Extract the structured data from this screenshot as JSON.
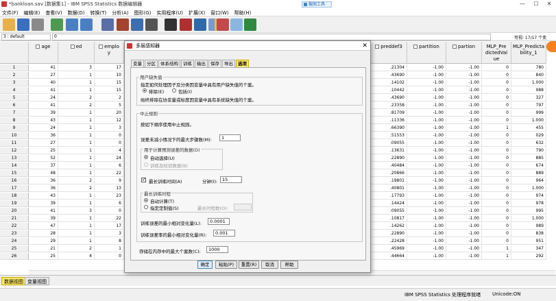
{
  "window": {
    "title": "*bankloan.sav [数据集1] - IBM SPSS Statistics 数据编辑器",
    "float_button": "截图工具",
    "controls": [
      "—",
      "☐",
      "✕"
    ]
  },
  "menu": [
    "文件(F)",
    "编辑(E)",
    "查看(V)",
    "数据(D)",
    "转换(T)",
    "分析(A)",
    "图形(G)",
    "实用程序(U)",
    "扩展(X)",
    "窗口(W)",
    "帮助(H)"
  ],
  "toolbar_icons": [
    "open-folder-icon",
    "save-icon",
    "print-icon",
    "dialog-recall-icon",
    "undo-icon",
    "redo-icon",
    "goto-case-icon",
    "goto-variable-icon",
    "variables-icon",
    "run-descriptives-icon",
    "find-icon",
    "insert-cases-icon",
    "insert-variable-icon",
    "split-file-icon",
    "weight-cases-icon",
    "value-labels-icon",
    "use-sets-icon",
    "show-all-icon"
  ],
  "refbar": {
    "cell_ref": "3 : default",
    "cell_value": "0",
    "var_count": "可视: 17/17 个变"
  },
  "grid": {
    "left_columns": [
      "age",
      "ed",
      "emplo\ny"
    ],
    "right_columns": [
      "preddef3",
      "partition",
      "partion",
      "MLP_Pre\ndictedVal\nue",
      "MLP_Predicta\nbility_1"
    ],
    "row_numbers": [
      "1",
      "2",
      "3",
      "4",
      "5",
      "6",
      "7",
      "8",
      "9",
      "10",
      "11",
      "12",
      "13",
      "14",
      "15",
      "16",
      "17",
      "18",
      "19",
      "20",
      "21",
      "22",
      "23",
      "24",
      "25",
      "26"
    ],
    "left_rows": [
      [
        "41",
        "3",
        "17"
      ],
      [
        "27",
        "1",
        "10"
      ],
      [
        "40",
        "1",
        "15"
      ],
      [
        "41",
        "1",
        "15"
      ],
      [
        "24",
        "2",
        "2"
      ],
      [
        "41",
        "2",
        "5"
      ],
      [
        "39",
        "1",
        "20"
      ],
      [
        "43",
        "1",
        "12"
      ],
      [
        "24",
        "1",
        "3"
      ],
      [
        "36",
        "1",
        "0"
      ],
      [
        "27",
        "1",
        "0"
      ],
      [
        "25",
        "1",
        "4"
      ],
      [
        "52",
        "1",
        "24"
      ],
      [
        "37",
        "1",
        "6"
      ],
      [
        "48",
        "1",
        "22"
      ],
      [
        "36",
        "2",
        "9"
      ],
      [
        "36",
        "2",
        "13"
      ],
      [
        "43",
        "1",
        "23"
      ],
      [
        "39",
        "1",
        "6"
      ],
      [
        "41",
        "3",
        "0"
      ],
      [
        "39",
        "1",
        "22"
      ],
      [
        "47",
        "1",
        "17"
      ],
      [
        "28",
        "1",
        "3"
      ],
      [
        "29",
        "1",
        "8"
      ],
      [
        "21",
        "2",
        "1"
      ],
      [
        "25",
        "4",
        "0"
      ]
    ],
    "right_rows": [
      [
        ".21304",
        "-1.00",
        "-1.00",
        "0",
        "780"
      ],
      [
        ".43690",
        "-1.00",
        "-1.00",
        "0",
        "840"
      ],
      [
        ".14102",
        "-1.00",
        "-1.00",
        "0",
        "1.000"
      ],
      [
        ".10442",
        "-1.00",
        "-1.00",
        "0",
        "988"
      ],
      [
        ".43690",
        "-1.00",
        "-1.00",
        "0",
        "327"
      ],
      [
        ".23358",
        "-1.00",
        "-1.00",
        "0",
        "797"
      ],
      [
        ".81709",
        "-1.00",
        "-1.00",
        "0",
        "999"
      ],
      [
        ".11336",
        "-1.00",
        "-1.00",
        "0",
        "1.000"
      ],
      [
        ".66390",
        "-1.00",
        "-1.00",
        "1",
        "455"
      ],
      [
        ".51553",
        "-1.00",
        "-1.00",
        "0",
        "029"
      ],
      [
        ".09055",
        "-1.00",
        "-1.00",
        "0",
        "632"
      ],
      [
        ".13631",
        "-1.00",
        "-1.00",
        "0",
        "790"
      ],
      [
        ".22890",
        "-1.00",
        "-1.00",
        "0",
        "885"
      ],
      [
        ".40484",
        "-1.00",
        "-1.00",
        "0",
        "674"
      ],
      [
        ".20866",
        "-1.00",
        "-1.00",
        "0",
        "889"
      ],
      [
        ".19801",
        "-1.00",
        "-1.00",
        "0",
        "964"
      ],
      [
        ".40801",
        "-1.00",
        "-1.00",
        "0",
        "1.000"
      ],
      [
        ".17793",
        "-1.00",
        "-1.00",
        "0",
        "974"
      ],
      [
        ".14424",
        "-1.00",
        "-1.00",
        "0",
        "978"
      ],
      [
        ".09055",
        "-1.00",
        "-1.00",
        "0",
        "995"
      ],
      [
        ".10817",
        "-1.00",
        "-1.00",
        "0",
        "1.000"
      ],
      [
        ".14262",
        "-1.00",
        "-1.00",
        "0",
        "989"
      ],
      [
        ".22890",
        "-1.00",
        "-1.00",
        "0",
        "838"
      ],
      [
        ".22428",
        "-1.00",
        "-1.00",
        "0",
        "951"
      ],
      [
        ".45969",
        "-1.00",
        "-1.00",
        "1",
        "347"
      ],
      [
        ".44664",
        "-1.00",
        "-1.00",
        "1",
        "292"
      ]
    ]
  },
  "sheet_tabs": {
    "data_view": "数据视图",
    "variable_view": "变量视图"
  },
  "status": {
    "processor": "IBM SPSS Statistics 处理程序就绪",
    "unicode": "Unicode:ON"
  },
  "dialog": {
    "title": "多层感知器",
    "close": "✕",
    "tabs": [
      "变量",
      "分区",
      "体系结构",
      "训练",
      "输出",
      "保存",
      "导出",
      "选项"
    ],
    "user_missing": {
      "legend": "用户缺失值",
      "desc": "指定如何处理因子及分类因变量中具有用户缺失值的个案。",
      "exclude": "排除(E)",
      "include": "包括(I)",
      "note": "始终排除在协变量或标度因变量中具有系统缺失值的个案。"
    },
    "stop_rules": {
      "legend": "中止规则",
      "desc": "按如下顺序使用中止规则。",
      "max_steps_label": "误差未减小情况下的最大步骤数(M):",
      "max_steps_value": "1",
      "error_data": {
        "legend": "用于计算预测误差的数据(D)",
        "auto": "自动选择(U)",
        "train_and_test": "训练及检验数据(B)"
      },
      "max_time_label": "最长训练时间(A)",
      "minutes_label": "分钟(I):",
      "minutes_value": "15",
      "max_epochs": {
        "legend": "最长训练时程",
        "auto": "自动计算(T)",
        "custom": "指定定制值(S)",
        "epochs_label": "最长时程数(O):"
      },
      "min_rel_change_label": "训练误差的最小相对变化量(L):",
      "min_rel_change_value": "0.0001",
      "min_rel_ratio_label": "训练误差率的最小相对变化量(R):",
      "min_rel_ratio_value": "0.001"
    },
    "max_cases_label": "存储在内存中的最大个案数(C):",
    "max_cases_value": "1000",
    "buttons": {
      "ok": "确定",
      "paste": "粘贴(P)",
      "reset": "重置(R)",
      "cancel": "取消",
      "help": "帮助"
    }
  },
  "colors": {
    "accent_tab": "#ffe86a",
    "orange_badge": "#f58220"
  }
}
